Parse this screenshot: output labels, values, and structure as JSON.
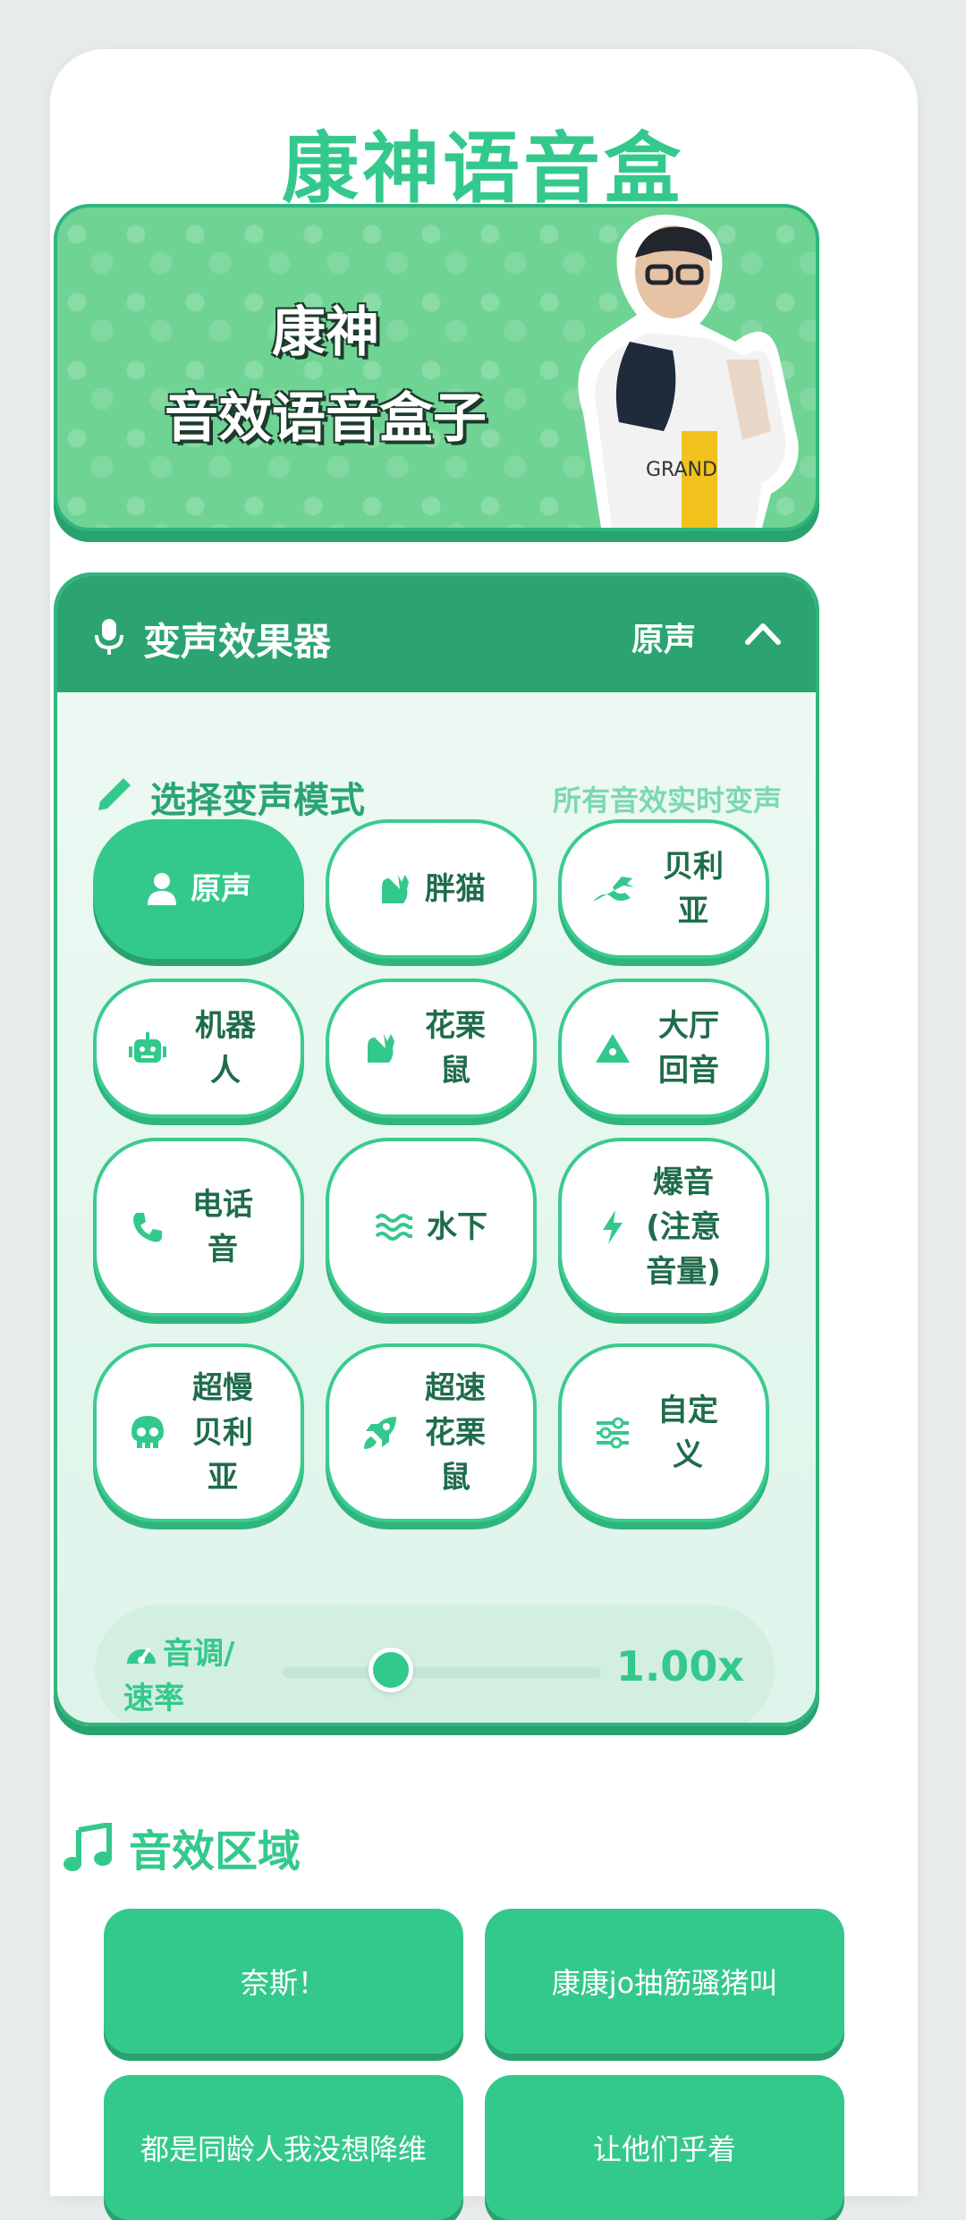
{
  "app": {
    "title": "康神语音盒"
  },
  "banner": {
    "line1": "康神",
    "line2": "音效语音盒子"
  },
  "voice_changer": {
    "title": "变声效果器",
    "current_mode": "原声",
    "select_label": "选择变声模式",
    "hint": "所有音效实时变声",
    "modes": [
      {
        "label": "原声",
        "icon": "user-icon",
        "active": true
      },
      {
        "label": "胖猫",
        "icon": "cat-icon"
      },
      {
        "label": "贝利亚",
        "icon": "dragon-icon"
      },
      {
        "label": "机器人",
        "icon": "robot-icon"
      },
      {
        "label": "花栗鼠",
        "icon": "cat-icon"
      },
      {
        "label": "大厅回音",
        "icon": "mountain-icon"
      },
      {
        "label": "电话音",
        "icon": "phone-icon"
      },
      {
        "label": "水下",
        "icon": "water-icon"
      },
      {
        "label": "爆音(注意音量)",
        "icon": "bolt-icon"
      },
      {
        "label": "超慢贝利亚",
        "icon": "skull-icon"
      },
      {
        "label": "超速花栗鼠",
        "icon": "rocket-icon"
      },
      {
        "label": "自定义",
        "icon": "sliders-icon"
      }
    ],
    "pitch": {
      "label": "音调/速率",
      "value_text": "1.00x",
      "position": 0.34
    }
  },
  "sfx": {
    "title": "音效区域",
    "items": [
      "奈斯！",
      "康康jo抽筋骚猪叫",
      "都是同龄人我没想降维",
      "让他们乎着"
    ]
  }
}
